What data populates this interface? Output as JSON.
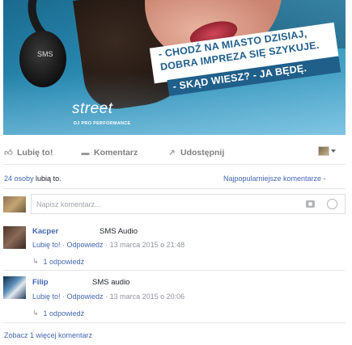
{
  "hero": {
    "promo_line1": "- CHODŹ NA MIASTO DZISIAJ,",
    "promo_line2": "DOBRA IMPREZA SIĘ SZYKUJE.",
    "promo_line3": "- SKĄD WIESZ? - JA BĘDĘ.",
    "brand": "street",
    "brand_sub": "DJ PRO PERFORMANCE",
    "headphone_logo": "SMS"
  },
  "actions": {
    "like_label": "Lubię to!",
    "comment_label": "Komentarz",
    "share_label": "Udostępnij",
    "like_icon": "thumbs-up-icon",
    "comment_icon": "comment-icon",
    "share_icon": "share-icon"
  },
  "likes": {
    "count_label": "24 osoby",
    "suffix": "lubią to.",
    "sort_label": "Najpopularniejsze komentarze -"
  },
  "composer": {
    "placeholder": "Napisz komentarz..."
  },
  "comments": [
    {
      "author": "Kacper",
      "text": "SMS Audio",
      "like": "Lubię to!",
      "sep1": " · ",
      "reply": "Odpowiedz",
      "sep2": " · ",
      "date": "13 marca 2015 o 21:48",
      "replies": "1 odpowiedź"
    },
    {
      "author": "Filip",
      "text": "SMS audio",
      "like": "Lubię to!",
      "sep1": " · ",
      "reply": "Odpowiedz",
      "sep2": " · ",
      "date": "13 marca 2015 o 20:06",
      "replies": "1 odpowiedź"
    }
  ],
  "more_comments": "Zobacz 1 więcej komentarz",
  "colors": {
    "link": "#4267b2",
    "muted": "#90949c",
    "promo_blue": "#1f5f8a"
  }
}
